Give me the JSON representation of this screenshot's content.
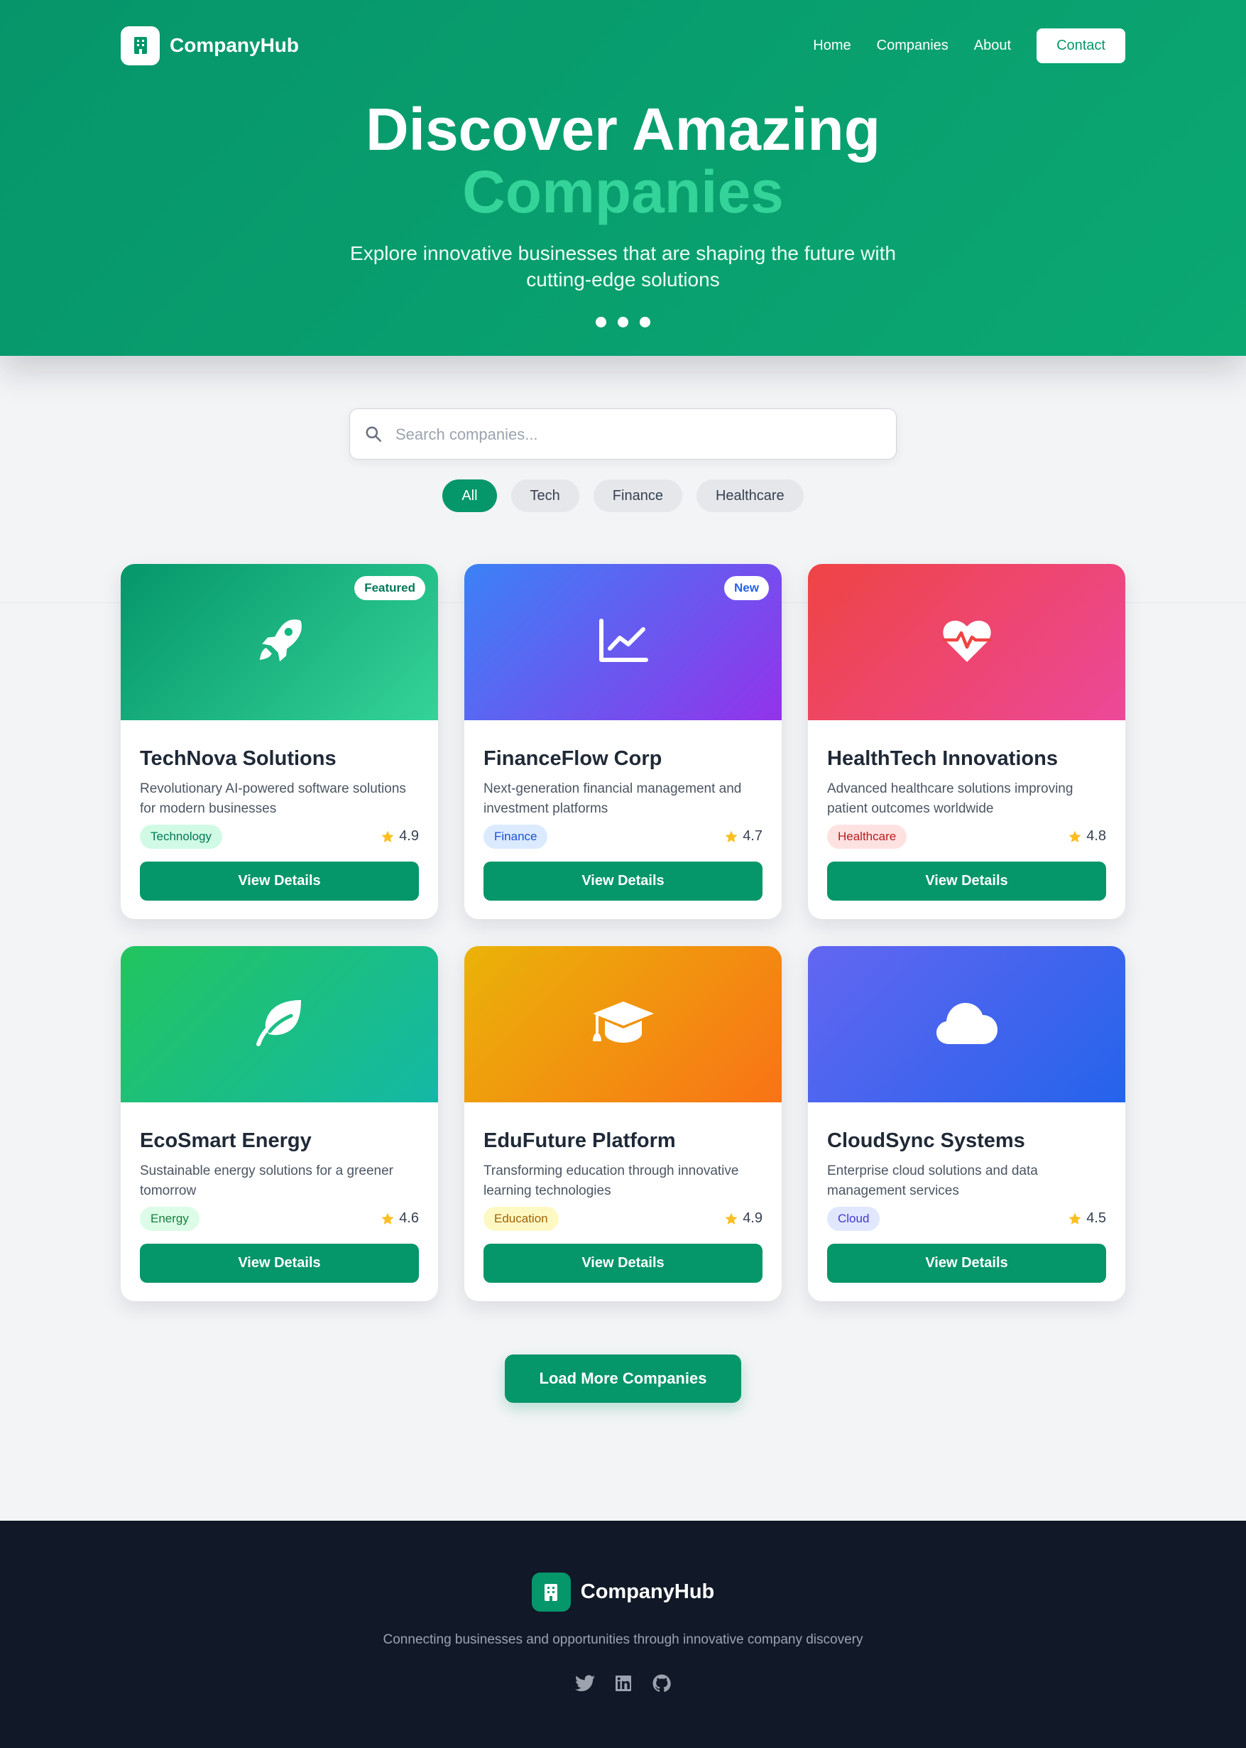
{
  "brand": {
    "name": "CompanyHub",
    "icon": "building-icon"
  },
  "nav": {
    "links": [
      "Home",
      "Companies",
      "About"
    ],
    "contact_label": "Contact"
  },
  "hero": {
    "title_line1": "Discover Amazing",
    "title_line2": "Companies",
    "subtitle": "Explore innovative businesses that are shaping the future with cutting-edge solutions",
    "slide_count": 3
  },
  "search": {
    "placeholder": "Search companies...",
    "value": "",
    "icon": "search-icon"
  },
  "filters": [
    {
      "label": "All",
      "active": true
    },
    {
      "label": "Tech",
      "active": false
    },
    {
      "label": "Finance",
      "active": false
    },
    {
      "label": "Healthcare",
      "active": false
    }
  ],
  "companies": [
    {
      "name": "TechNova Solutions",
      "description": "Revolutionary AI-powered software solutions for modern businesses",
      "category": "Technology",
      "rating": "4.9",
      "badge": "Featured",
      "icon": "rocket-icon",
      "gradient": [
        "#059669",
        "#34d399"
      ],
      "tag_bg": "#d1fae5",
      "tag_color": "#047857",
      "badge_color": "#047857",
      "button_label": "View Details"
    },
    {
      "name": "FinanceFlow Corp",
      "description": "Next-generation financial management and investment platforms",
      "category": "Finance",
      "rating": "4.7",
      "badge": "New",
      "icon": "chart-line-icon",
      "gradient": [
        "#3b82f6",
        "#9333ea"
      ],
      "tag_bg": "#dbeafe",
      "tag_color": "#1d4ed8",
      "badge_color": "#2563eb",
      "button_label": "View Details"
    },
    {
      "name": "HealthTech Innovations",
      "description": "Advanced healthcare solutions improving patient outcomes worldwide",
      "category": "Healthcare",
      "rating": "4.8",
      "badge": "",
      "icon": "heart-pulse-icon",
      "gradient": [
        "#ef4444",
        "#ec4899"
      ],
      "tag_bg": "#fee2e2",
      "tag_color": "#b91c1c",
      "badge_color": "#b91c1c",
      "button_label": "View Details"
    },
    {
      "name": "EcoSmart Energy",
      "description": "Sustainable energy solutions for a greener tomorrow",
      "category": "Energy",
      "rating": "4.6",
      "badge": "",
      "icon": "leaf-icon",
      "gradient": [
        "#22c55e",
        "#14b8a6"
      ],
      "tag_bg": "#dcfce7",
      "tag_color": "#15803d",
      "badge_color": "#15803d",
      "button_label": "View Details"
    },
    {
      "name": "EduFuture Platform",
      "description": "Transforming education through innovative learning technologies",
      "category": "Education",
      "rating": "4.9",
      "badge": "",
      "icon": "graduation-cap-icon",
      "gradient": [
        "#eab308",
        "#f97316"
      ],
      "tag_bg": "#fef9c3",
      "tag_color": "#a16207",
      "badge_color": "#a16207",
      "button_label": "View Details"
    },
    {
      "name": "CloudSync Systems",
      "description": "Enterprise cloud solutions and data management services",
      "category": "Cloud",
      "rating": "4.5",
      "badge": "",
      "icon": "cloud-icon",
      "gradient": [
        "#6366f1",
        "#2563eb"
      ],
      "tag_bg": "#e0e7ff",
      "tag_color": "#4338ca",
      "badge_color": "#4338ca",
      "button_label": "View Details"
    }
  ],
  "load_more_label": "Load More Companies",
  "footer": {
    "brand": "CompanyHub",
    "tagline": "Connecting businesses and opportunities through innovative company discovery",
    "socials": [
      "twitter-icon",
      "linkedin-icon",
      "github-icon"
    ]
  },
  "colors": {
    "primary": "#059669",
    "accent": "#34d399",
    "star": "#fbbf24",
    "footer_bg": "#111827"
  }
}
